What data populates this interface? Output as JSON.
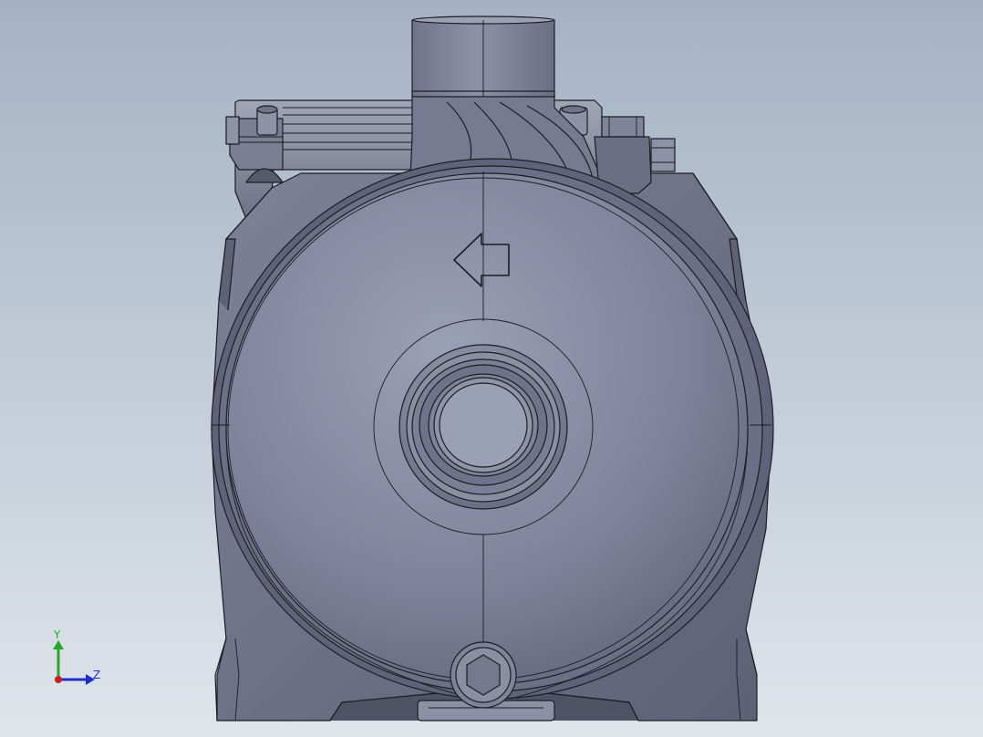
{
  "viewport": {
    "background_top": "#a4b2c4",
    "background_bottom": "#dfe5eb",
    "model_fill_dark": "#6b7086",
    "model_fill_light": "#9aa0b6",
    "edge_color": "#1c1d22",
    "display_style": "shaded-with-edges"
  },
  "model": {
    "name": "centrifugal-pump",
    "view": "front",
    "features": [
      "outlet-port",
      "inlet-port",
      "drain-plug",
      "flow-direction-arrow",
      "motor-housing",
      "base-feet"
    ]
  },
  "triad": {
    "x_label": "",
    "y_label": "Y",
    "z_label": "Z",
    "y_color": "#2aa52a",
    "z_color": "#1f2fc8",
    "x_color": "#c81f1f"
  }
}
